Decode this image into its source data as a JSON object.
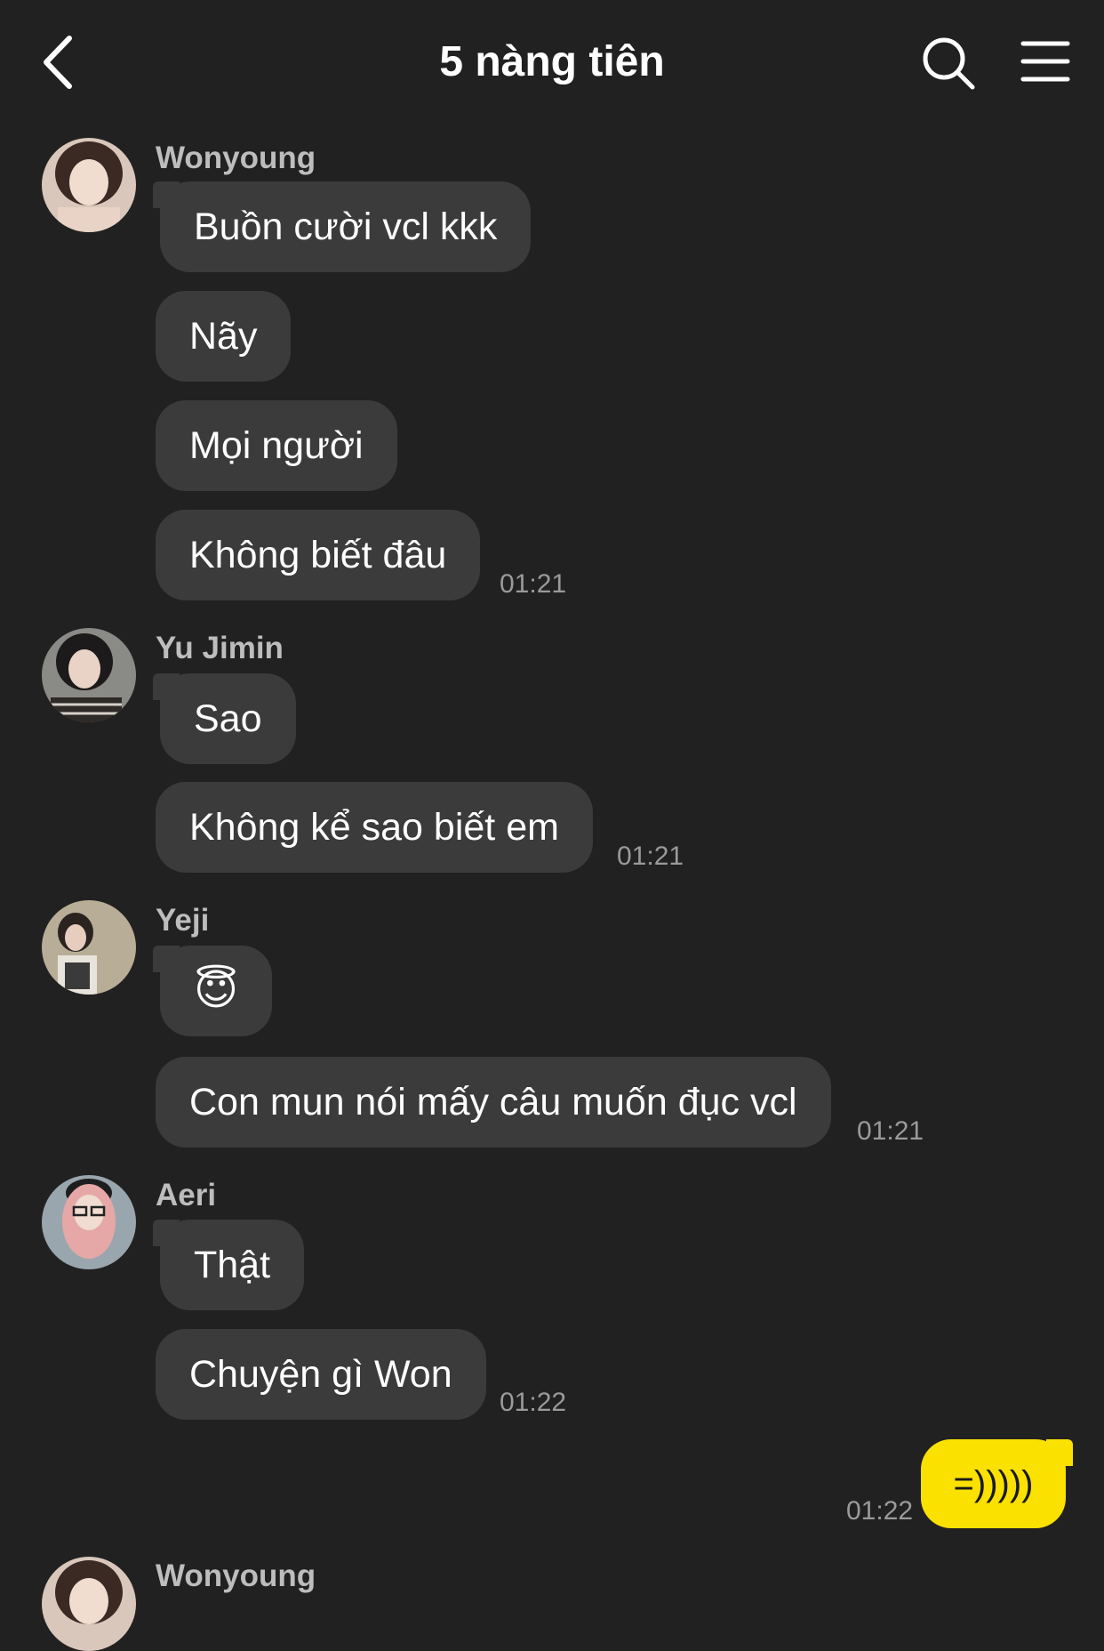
{
  "header": {
    "title": "5 nàng tiên"
  },
  "messages": [
    {
      "sender": "Wonyoung",
      "bubbles": [
        "Buồn cười vcl kkk",
        "Nãy",
        "Mọi người",
        "Không biết đâu"
      ],
      "time": "01:21"
    },
    {
      "sender": "Yu Jimin",
      "bubbles": [
        "Sao",
        "Không kể sao biết em"
      ],
      "time": "01:21"
    },
    {
      "sender": "Yeji",
      "bubbles": [
        "😇",
        "Con mun nói mấy câu muốn đục vcl"
      ],
      "time": "01:21"
    },
    {
      "sender": "Aeri",
      "bubbles": [
        "Thật",
        "Chuyện gì Won"
      ],
      "time": "01:22"
    },
    {
      "sender": "Wonyoung"
    }
  ],
  "my_message": {
    "text": "=)))))",
    "time": "01:22"
  },
  "colors": {
    "background": "#212121",
    "bubble": "#3b3b3b",
    "my_bubble": "#fae100",
    "timestamp": "#9a9a9a"
  },
  "icons": {
    "back": "chevron-left-icon",
    "search": "search-icon",
    "menu": "hamburger-menu-icon"
  }
}
